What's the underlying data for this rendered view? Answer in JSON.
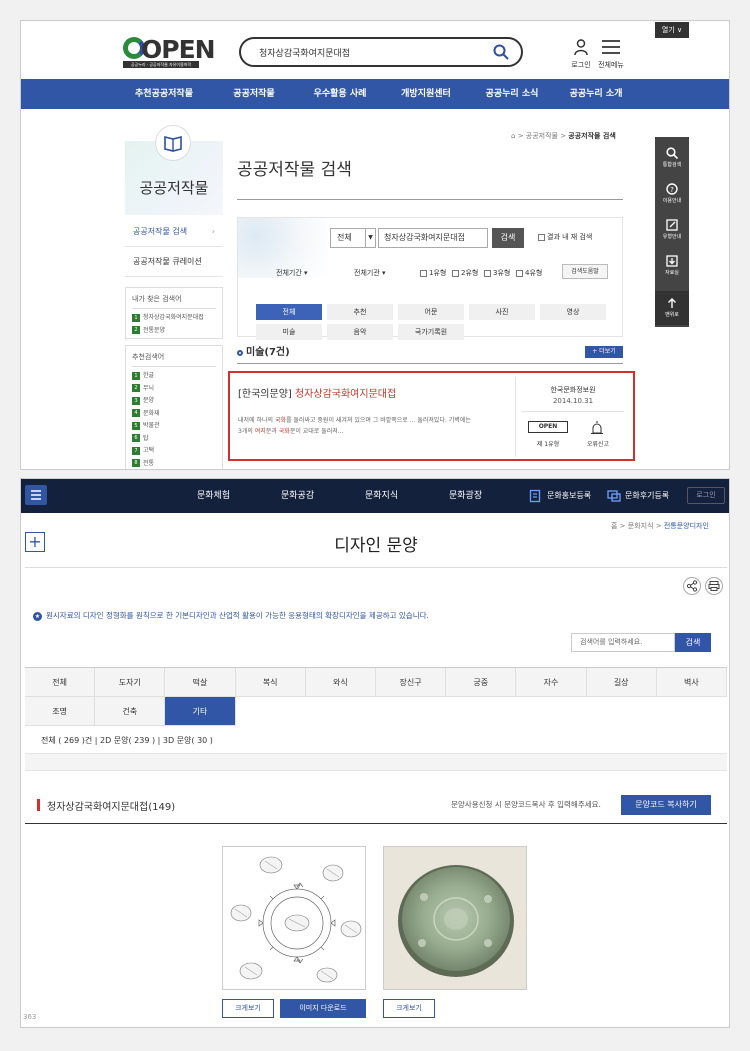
{
  "panel1": {
    "logo": {
      "text": "OPEN",
      "sub": "공공누리 · 공공저작물 자유이용허락"
    },
    "search": {
      "value": "청자상감국화여지문대접"
    },
    "header": {
      "login": "로그인",
      "menu": "전체메뉴",
      "open": "열기"
    },
    "nav": [
      "추천공공저작물",
      "공공저작물",
      "우수활용 사례",
      "개방지원센터",
      "공공누리 소식",
      "공공누리 소개"
    ],
    "breadcrumb": {
      "path": "> 공공저작물 > ",
      "current": "공공저작물 검색"
    },
    "sidebar": {
      "hero": "공공저작물",
      "links": [
        "공공저작물 검색",
        "공공저작물 큐레이션"
      ],
      "recent_title": "내가 찾은 검색어",
      "recent": [
        {
          "n": "1",
          "text": "청자상감국화여지문대접"
        },
        {
          "n": "2",
          "text": "전통문양"
        }
      ],
      "suggest_title": "추천검색어",
      "suggest": [
        {
          "n": "1",
          "text": "한글"
        },
        {
          "n": "2",
          "text": "무늬"
        },
        {
          "n": "3",
          "text": "문양"
        },
        {
          "n": "4",
          "text": "문화재"
        },
        {
          "n": "5",
          "text": "박물관"
        },
        {
          "n": "6",
          "text": "탑"
        },
        {
          "n": "7",
          "text": "고택"
        },
        {
          "n": "8",
          "text": "전통"
        }
      ]
    },
    "page_title": "공공저작물 검색",
    "filter": {
      "select": "전체",
      "query": "청자상감국화여지문대접",
      "button": "검색",
      "within": "결과 내 재 검색",
      "period": "전체기간",
      "org": "전체기관",
      "types": [
        "1유형",
        "2유형",
        "3유형",
        "4유형"
      ],
      "help": "검색도움말",
      "cats_row1": [
        "전체",
        "추천",
        "어문",
        "사진",
        "영상"
      ],
      "cats_row2": [
        "미술",
        "음악",
        "국가기록원"
      ]
    },
    "result": {
      "title": "미술(7건)",
      "more": "+ 더보기",
      "item_title_prefix": "[한국의문양] ",
      "item_title_hl": "청자상감국화여지문대접",
      "desc_1": "내저에 하나의 ",
      "desc_red1": "국화",
      "desc_2": "를 둘러싸고 중원이 새겨져 있으며 그 바깥쪽으로 ... 둘러져있다. 기벽에는",
      "desc_3": "3개의 ",
      "desc_red2": "여지",
      "desc_4": "문과 ",
      "desc_red3": "국화",
      "desc_5": "문이 교대로 둘러져...",
      "org": "한국문화정보원",
      "date": "2014.10.31",
      "badge": "OPEN",
      "type": "제 1유형",
      "report": "오류신고"
    },
    "quick": [
      "통합검색",
      "이용안내",
      "유형안내",
      "자료실",
      "맨위로"
    ]
  },
  "panel2": {
    "nav": [
      "문화체험",
      "문화공감",
      "문화지식",
      "문화광장"
    ],
    "extra": [
      "문화홍보등록",
      "문화후기등록"
    ],
    "login": "로그인",
    "breadcrumb": {
      "path": "홈 > 문화지식 > ",
      "current": "전통문양디자인"
    },
    "plus": "+",
    "title": "디자인 문양",
    "notice": "원시자료의 디자인 정형화를 원칙으로 한 기본디자인과 산업적 활용이 가능한 응용형태의 확장디자인을 제공하고 있습니다.",
    "search_placeholder": "검색어를 입력하세요.",
    "search_button": "검색",
    "tabs_row1": [
      "전체",
      "도자기",
      "떡살",
      "복식",
      "와식",
      "장신구",
      "궁중",
      "자수",
      "길상",
      "벽사"
    ],
    "tabs_row2": [
      "조명",
      "건축",
      "기타"
    ],
    "counts": "전체 ( 269 )건  |  2D 문양( 239 )  |  3D 문양( 30 )",
    "result_title": "청자상감국화여지문대접(149)",
    "result_hint": "문양사용신청 시 문양코드복사 후 입력해주세요.",
    "copy_button": "문양코드 복사하기",
    "btn_zoom": "크게보기",
    "btn_download": "이미지 다운로드",
    "page_no": "363"
  },
  "colors": {
    "primary": "#3056a5",
    "dark_nav": "#14213d",
    "highlight": "#d32f2f"
  }
}
